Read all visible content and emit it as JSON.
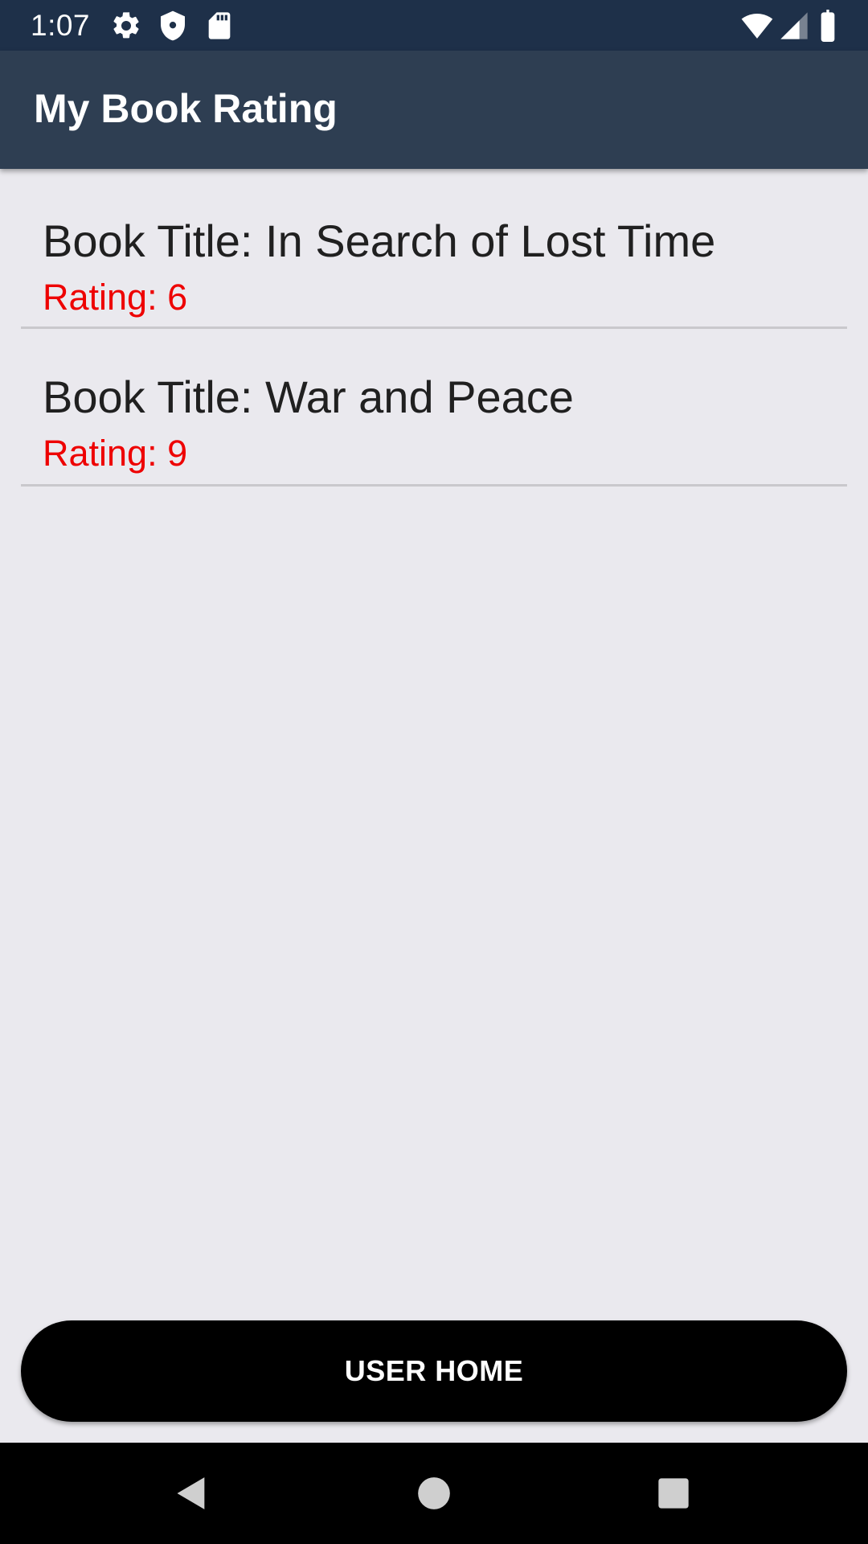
{
  "status_bar": {
    "time": "1:07",
    "icons": [
      "gear-icon",
      "shield-icon",
      "sd-card-icon",
      "wifi-icon",
      "signal-icon",
      "battery-icon"
    ]
  },
  "app_bar": {
    "title": "My Book Rating"
  },
  "books": [
    {
      "title": "Book Title: In Search of Lost Time",
      "rating": "Rating: 6"
    },
    {
      "title": "Book Title: War and Peace",
      "rating": "Rating: 9"
    }
  ],
  "user_home_button": {
    "label": "USER HOME"
  },
  "nav_bar": {
    "icons": [
      "back-icon",
      "home-icon",
      "recents-icon"
    ]
  },
  "colors": {
    "status_bar": "#1e3049",
    "app_bar": "#2e3e52",
    "background": "#eae9ee",
    "rating_text": "#ee0000",
    "button": "#000000"
  }
}
